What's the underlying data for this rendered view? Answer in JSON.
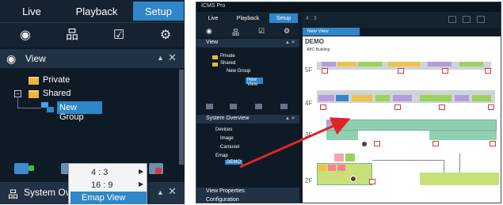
{
  "left": {
    "tabs": {
      "live": "Live",
      "playback": "Playback",
      "setup": "Setup"
    },
    "view_label": "View",
    "tree": {
      "private": "Private",
      "shared": "Shared",
      "new_group": "New Group"
    },
    "system_overview_label": "System Ove",
    "context_menu": {
      "ratio_4_3": "4 : 3",
      "ratio_16_9": "16 : 9",
      "emap_view": "Emap View"
    }
  },
  "right": {
    "window_title": "ICMS Pro",
    "tabs": {
      "live": "Live",
      "playback": "Playback",
      "setup": "Setup"
    },
    "view_label": "View",
    "tree": {
      "private": "Private",
      "shared": "Shared",
      "new_group": "New Group",
      "new_view": "New View"
    },
    "system_overview_label": "System Overview",
    "overview_items": {
      "devices": "Devices",
      "image": "Image",
      "carousel": "Carousel",
      "emap": "Emap",
      "demo": "DEMO"
    },
    "view_properties_label": "View Properties",
    "configuration_label": "Configuration",
    "ratio_label": "4 : 3",
    "canvas_tab": "New View",
    "emap": {
      "title": "DEMO",
      "building": "ABC Building",
      "floors": [
        "5F",
        "4F",
        "3F",
        "2F"
      ]
    }
  },
  "colors": {
    "accent": "#2f86c8",
    "panel_dark": "#0e1a26",
    "header": "#213244",
    "folder": "#f0b33c",
    "arrow": "#e02424"
  }
}
